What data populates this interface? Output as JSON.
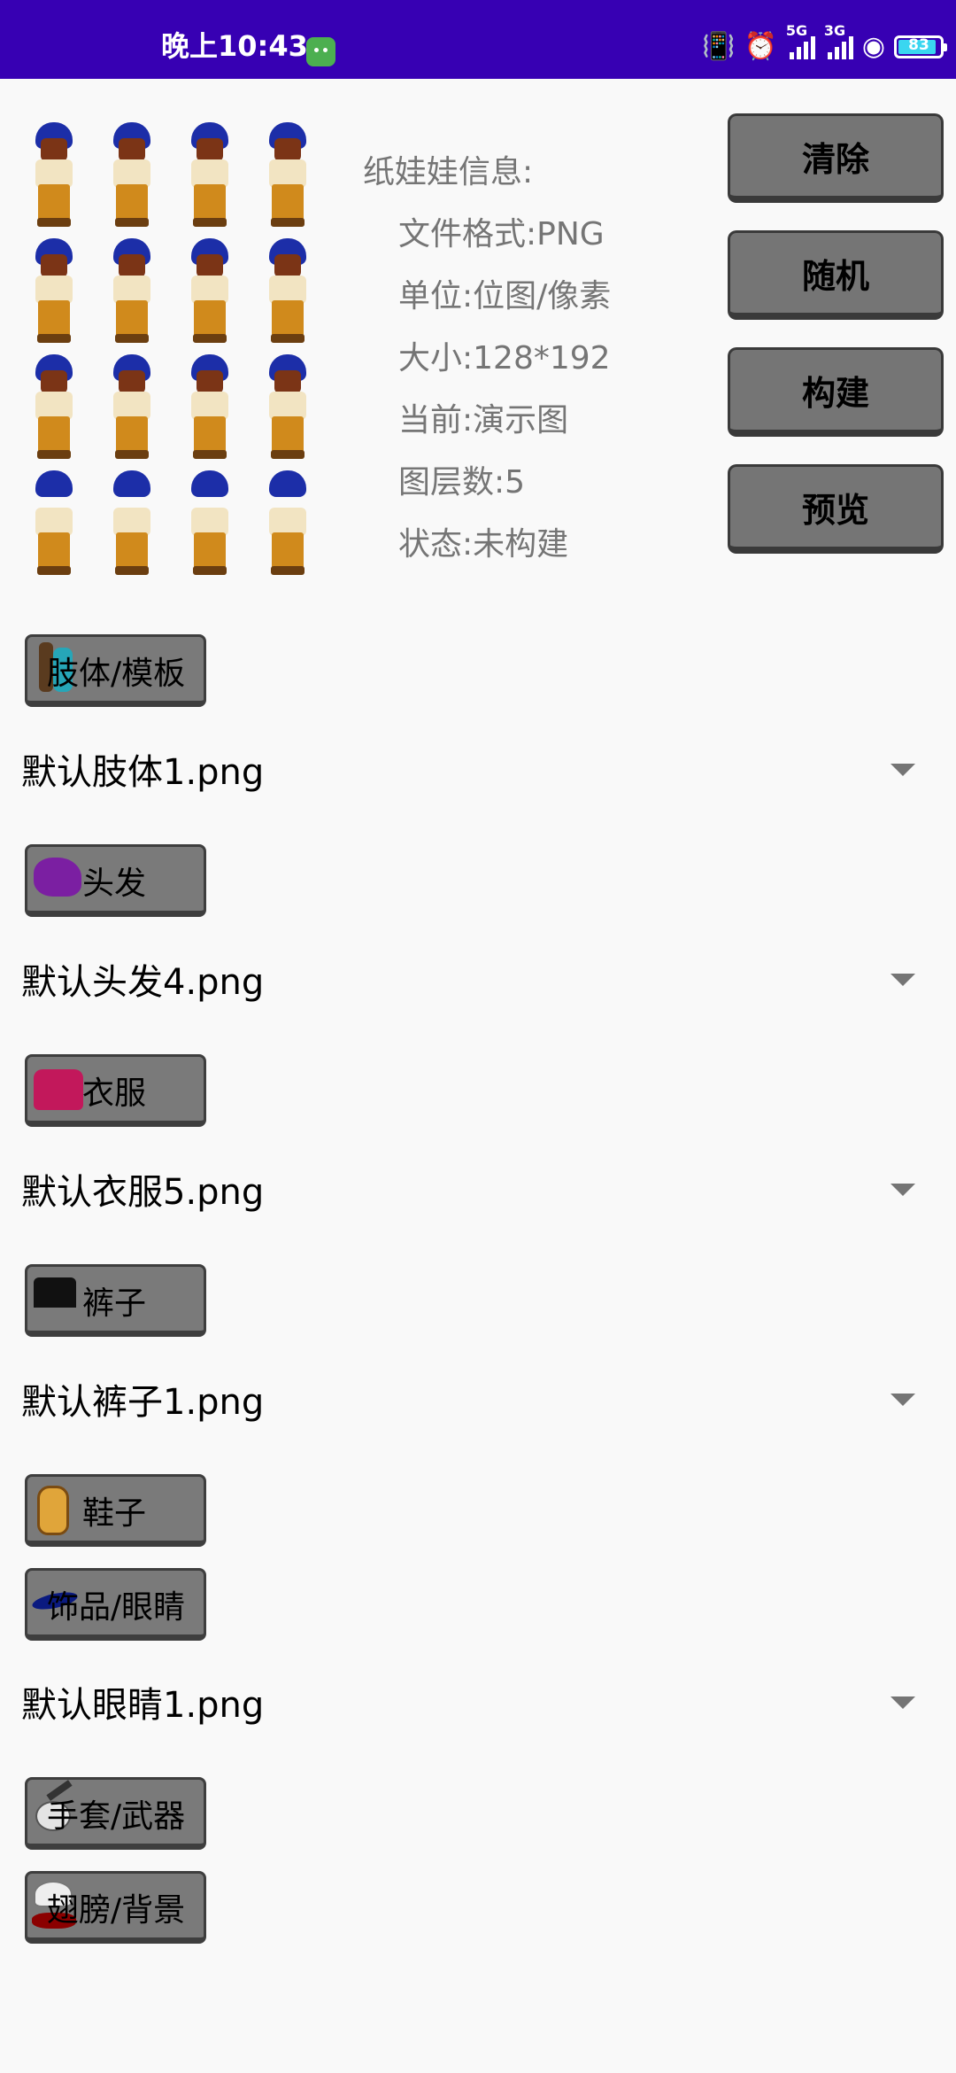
{
  "status_bar": {
    "time": "晚上10:43",
    "network_5g": "5G",
    "network_3g": "3G",
    "battery_level": "83"
  },
  "info": {
    "title": "纸娃娃信息:",
    "format": "文件格式:PNG",
    "unit": "单位:位图/像素",
    "size": "大小:128*192",
    "current": "当前:演示图",
    "layers": "图层数:5",
    "state": "状态:未构建"
  },
  "actions": {
    "clear": "清除",
    "random": "随机",
    "build": "构建",
    "preview": "预览"
  },
  "categories": {
    "limbs": "肢体/模板",
    "hair": "头发",
    "clothes": "衣服",
    "pants": "裤子",
    "shoes": "鞋子",
    "accessory_eyes": "饰品/眼睛",
    "gloves_weapons": "手套/武器",
    "wings_background": "翅膀/背景"
  },
  "selections": {
    "limbs": "默认肢体1.png",
    "hair": "默认头发4.png",
    "clothes": "默认衣服5.png",
    "pants": "默认裤子1.png",
    "eyes": "默认眼睛1.png"
  },
  "colors": {
    "status_bar": "#3700b3",
    "button_gray": "#757575",
    "info_text": "#757575"
  },
  "icons": [
    "limb-template-icon",
    "hair-icon",
    "clothes-icon",
    "pants-icon",
    "shoes-icon",
    "eyes-icon",
    "gloves-icon",
    "wings-icon"
  ]
}
